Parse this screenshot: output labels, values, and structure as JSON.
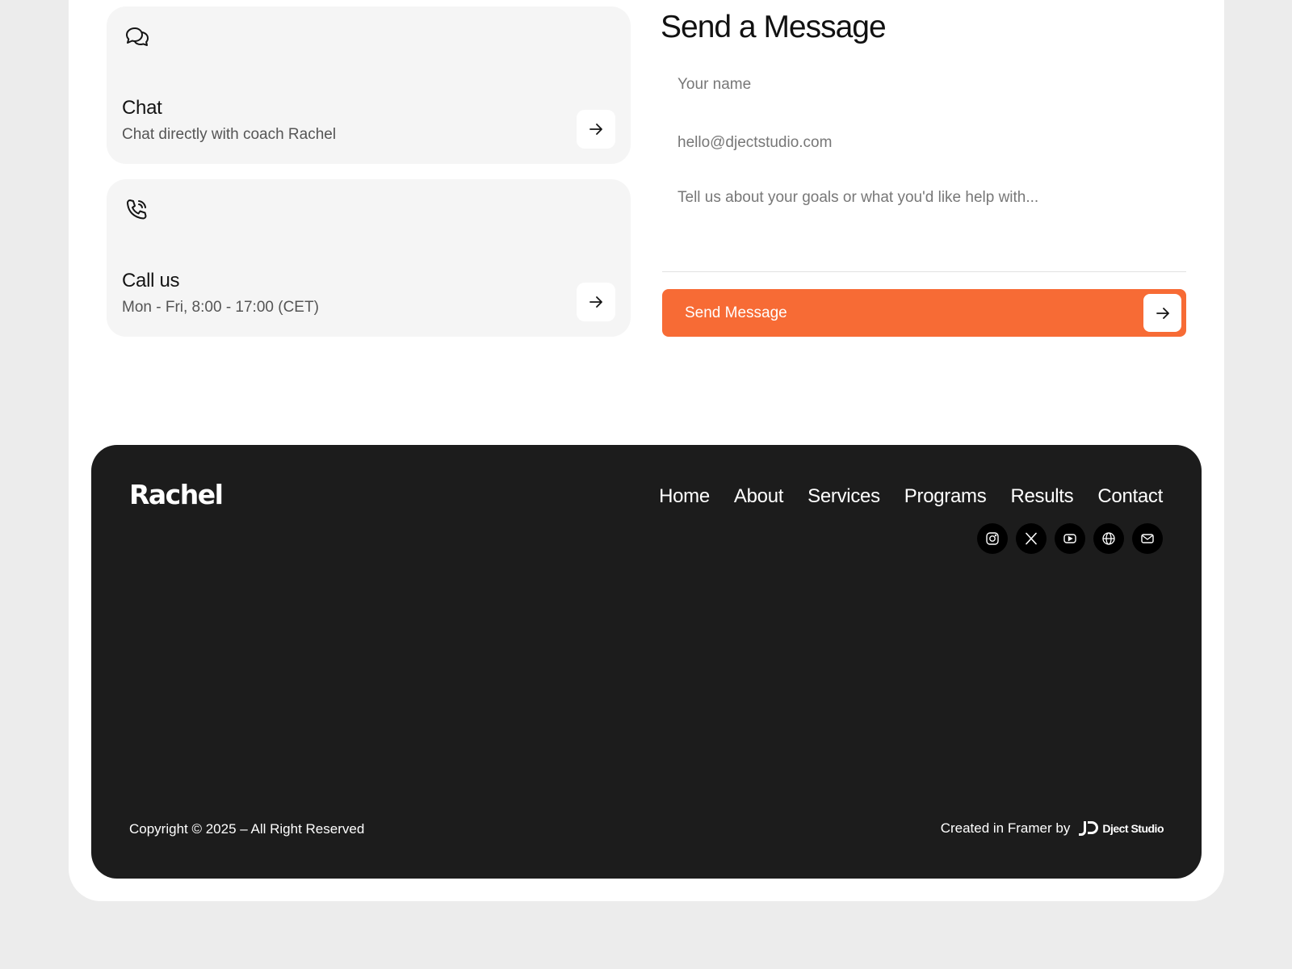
{
  "contact_cards": [
    {
      "icon": "chat-bubbles-icon",
      "title": "Chat",
      "subtitle": "Chat directly with coach Rachel"
    },
    {
      "icon": "phone-call-icon",
      "title": "Call us",
      "subtitle": "Mon - Fri, 8:00 - 17:00 (CET)"
    }
  ],
  "form": {
    "title": "Send a Message",
    "name_placeholder": "Your name",
    "email_placeholder": "hello@djectstudio.com",
    "message_placeholder": "Tell us about your goals or what you'd like help with...",
    "submit_label": "Send Message"
  },
  "colors": {
    "accent": "#f76b35",
    "footer_bg": "#1c1c1c",
    "card_bg": "#f5f5f5"
  },
  "footer": {
    "logo": "Rachel",
    "nav": [
      "Home",
      "About",
      "Services",
      "Programs",
      "Results",
      "Contact"
    ],
    "social_icons": [
      "instagram-icon",
      "x-icon",
      "youtube-icon",
      "globe-icon",
      "mail-icon"
    ],
    "copyright": "Copyright © 2025 – All Right Reserved",
    "credit_prefix": "Created in Framer by",
    "credit_brand": "Dject Studio"
  }
}
